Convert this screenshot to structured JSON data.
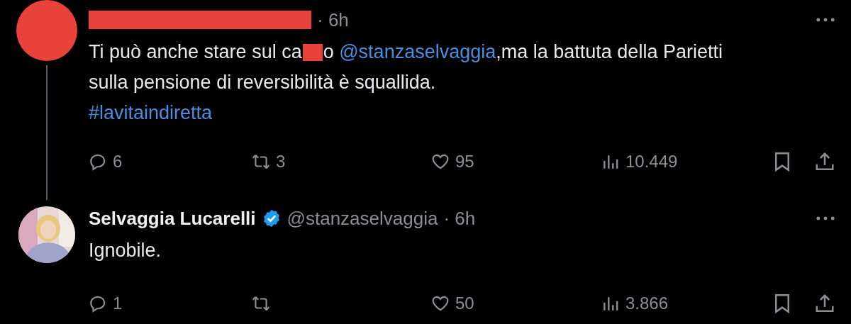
{
  "tweets": [
    {
      "avatar": {
        "kind": "redacted"
      },
      "author_redacted": true,
      "meta": "· 6h",
      "thread_line": true,
      "body": [
        [
          {
            "kind": "text",
            "text": "Ti può anche stare sul ca"
          },
          {
            "kind": "redaction"
          },
          {
            "kind": "text",
            "text": "o "
          },
          {
            "kind": "mention",
            "text": "@stanzaselvaggia"
          },
          {
            "kind": "text",
            "text": ",ma la battuta della Parietti"
          }
        ],
        [
          {
            "kind": "text",
            "text": "sulla pensione di reversibilità è squallida."
          }
        ],
        [
          {
            "kind": "mention",
            "text": "#lavitaindiretta"
          }
        ]
      ],
      "actions": [
        {
          "kind": "reply",
          "count": "6"
        },
        {
          "kind": "repost",
          "count": "3"
        },
        {
          "kind": "like",
          "count": "95"
        },
        {
          "kind": "views",
          "count": "10.449"
        },
        {
          "kind": "bookmark"
        },
        {
          "kind": "share"
        }
      ]
    },
    {
      "avatar": {
        "kind": "picture"
      },
      "author_redacted": false,
      "name": "Selvaggia Lucarelli",
      "verified": true,
      "handle": "@stanzaselvaggia",
      "meta": "· 6h",
      "thread_line": false,
      "body": [
        [
          {
            "kind": "text",
            "text": "Ignobile."
          }
        ]
      ],
      "actions": [
        {
          "kind": "reply",
          "count": "1"
        },
        {
          "kind": "repost"
        },
        {
          "kind": "like",
          "count": "50"
        },
        {
          "kind": "views",
          "count": "3.866"
        },
        {
          "kind": "bookmark"
        },
        {
          "kind": "share"
        }
      ]
    }
  ]
}
